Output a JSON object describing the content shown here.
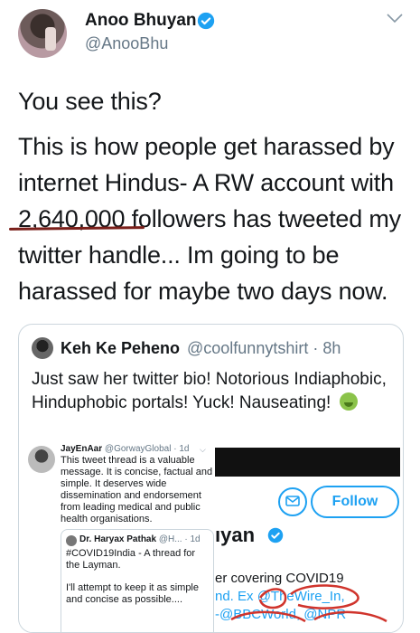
{
  "tweet": {
    "author_name": "Anoo Bhuyan",
    "author_handle": "@AnooBhu",
    "paragraphs": [
      "You see this?",
      "This is how people get harassed by internet Hindus- A RW account with 2,640,000 followers has tweeted my twitter handle... Im going to be harassed for maybe two days now."
    ]
  },
  "quoted": {
    "name": "Keh Ke Peheno",
    "handle": "@coolfunnytshirt",
    "time": "· 8h",
    "text": "Just saw her twitter bio! Notorious Indiaphobic, Hinduphobic portals! Yuck! Nauseating!"
  },
  "embed": {
    "name": "JayEnAar",
    "handle": "@GorwayGlobal",
    "time": "· 1d",
    "text": "This tweet thread is a valuable message. It is concise, factual and simple. It deserves wide dissemination and endorsement from leading medical and public health organisations.",
    "inner": {
      "name": "Dr. Haryax Pathak",
      "handle": "@H...",
      "time": "· 1d",
      "line1": "#COVID19India - A thread for the Layman.",
      "line2": "I'll attempt to keep it as simple and concise as possible...."
    },
    "follow_label": "Follow",
    "profile_name_fragment": "ıyan",
    "bio_line1": "er covering COVID19",
    "bio_line2": "nd. Ex @TheWire_In,",
    "bio_line3": "-@BBCWorld, @NPR"
  },
  "colors": {
    "accent": "#1da1f2",
    "muted": "#657786",
    "underline": "#7a1f1a"
  }
}
